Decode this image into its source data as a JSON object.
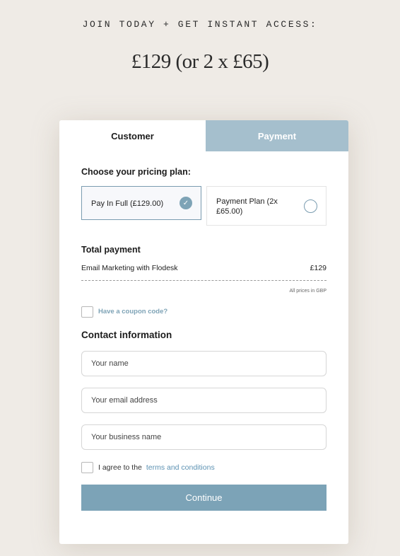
{
  "header": {
    "kicker": "JOIN TODAY + GET INSTANT ACCESS:",
    "price": "£129 (or 2 x £65)"
  },
  "tabs": [
    {
      "label": "Customer",
      "active": true
    },
    {
      "label": "Payment",
      "active": false
    }
  ],
  "pricing": {
    "heading": "Choose your pricing plan:",
    "plans": [
      {
        "label": "Pay In Full (£129.00)",
        "selected": true,
        "icon": "check-icon"
      },
      {
        "label": "Payment Plan (2x £65.00)",
        "selected": false,
        "icon": "radio-icon"
      }
    ]
  },
  "total": {
    "heading": "Total payment",
    "item_label": "Email Marketing with Flodesk",
    "item_amount": "£129",
    "note": "All prices in GBP"
  },
  "coupon": {
    "label": "Have a coupon code?",
    "checked": false
  },
  "contact": {
    "heading": "Contact information",
    "name_placeholder": "Your name",
    "email_placeholder": "Your email address",
    "business_placeholder": "Your business name"
  },
  "terms": {
    "prefix": "I agree to the",
    "link": "terms and conditions",
    "checked": false
  },
  "cta": {
    "label": "Continue"
  },
  "colors": {
    "page_background": "#efebe6",
    "accent": "#7ca3b7",
    "inactive_tab": "#a5bfcd",
    "link": "#5d92b3"
  }
}
